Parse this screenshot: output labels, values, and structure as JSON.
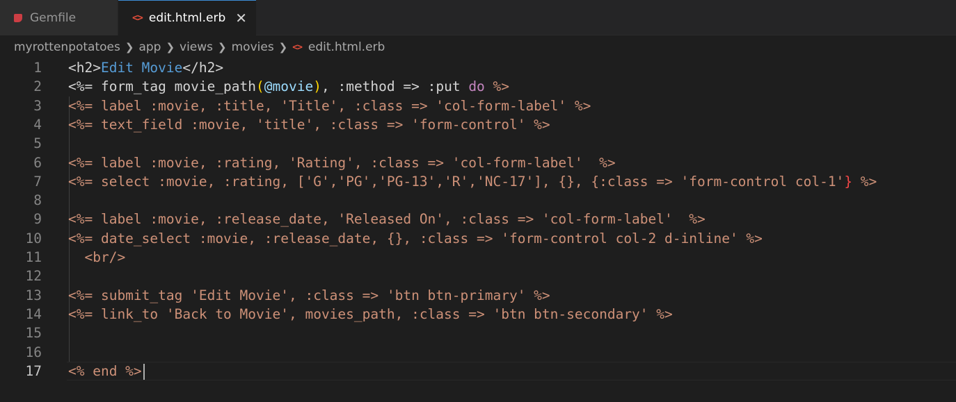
{
  "tabs": [
    {
      "label": "Gemfile",
      "icon": "ruby-icon",
      "active": false
    },
    {
      "label": "edit.html.erb",
      "icon": "html-icon",
      "active": true
    }
  ],
  "breadcrumb": [
    "myrottenpotatoes",
    "app",
    "views",
    "movies",
    "edit.html.erb"
  ],
  "editor": {
    "current_line": 17,
    "lines": [
      {
        "n": "1"
      },
      {
        "n": "2"
      },
      {
        "n": "3"
      },
      {
        "n": "4"
      },
      {
        "n": "5"
      },
      {
        "n": "6"
      },
      {
        "n": "7"
      },
      {
        "n": "8"
      },
      {
        "n": "9"
      },
      {
        "n": "10"
      },
      {
        "n": "11"
      },
      {
        "n": "12"
      },
      {
        "n": "13"
      },
      {
        "n": "14"
      },
      {
        "n": "15"
      },
      {
        "n": "16"
      },
      {
        "n": "17"
      }
    ],
    "code": [
      "<h2>Edit Movie</h2>",
      "<%= form_tag movie_path(@movie), :method => :put do %>",
      "  <%= label :movie, :title, 'Title', :class => 'col-form-label' %>",
      "  <%= text_field :movie, 'title', :class => 'form-control' %>",
      "",
      "  <%= label :movie, :rating, 'Rating', :class => 'col-form-label'  %>",
      "  <%= select :movie, :rating, ['G','PG','PG-13','R','NC-17'], {}, {:class => 'form-control col-1'} %>",
      "",
      "  <%= label :movie, :release_date, 'Released On', :class => 'col-form-label'  %>",
      "  <%= date_select :movie, :release_date, {}, :class => 'form-control col-2 d-inline' %>",
      "  <br/>",
      "",
      "  <%= submit_tag 'Edit Movie', :class => 'btn btn-primary' %>",
      "  <%= link_to 'Back to Movie', movies_path, :class => 'btn btn-secondary' %>",
      "",
      "",
      "<% end %>"
    ]
  }
}
